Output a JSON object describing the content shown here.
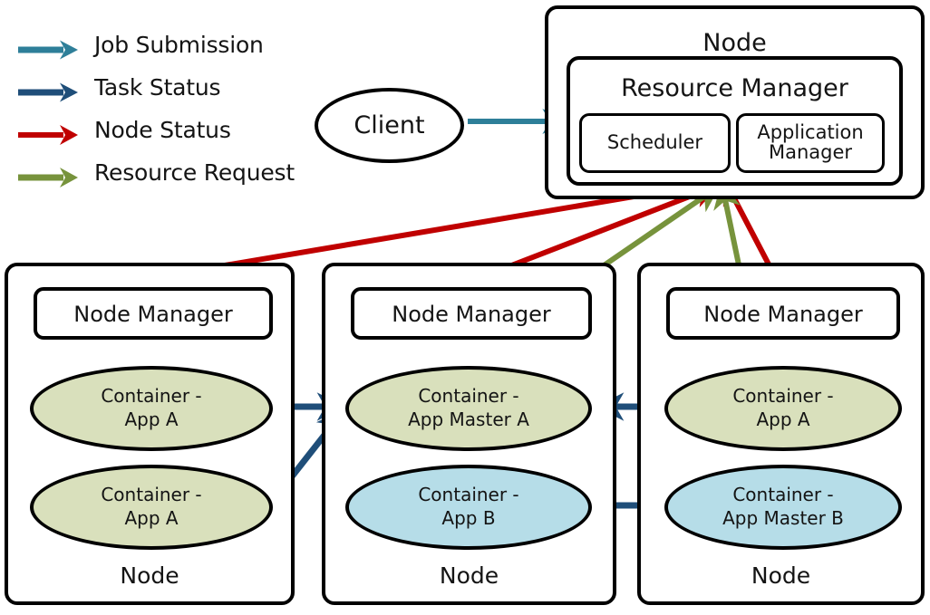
{
  "colors": {
    "job_submission": "#2E7F99",
    "task_status": "#1F4E79",
    "node_status": "#C00000",
    "resource_request": "#77933C",
    "container_app_fill": "#D9E0BC",
    "container_appb_fill": "#B6DDE8",
    "outline": "#000000",
    "text": "#141414"
  },
  "legend": {
    "items": [
      {
        "label": "Job Submission",
        "color_key": "job_submission",
        "icon": "arrow-right-icon"
      },
      {
        "label": "Task Status",
        "color_key": "task_status",
        "icon": "arrow-right-icon"
      },
      {
        "label": "Node Status",
        "color_key": "node_status",
        "icon": "arrow-right-icon"
      },
      {
        "label": "Resource Request",
        "color_key": "resource_request",
        "icon": "arrow-right-icon"
      }
    ]
  },
  "client": {
    "label": "Client"
  },
  "master_node": {
    "title": "Node",
    "resource_manager": {
      "title": "Resource Manager",
      "components": [
        {
          "label": "Scheduler"
        },
        {
          "label": "Application\nManager"
        }
      ]
    }
  },
  "worker_nodes": [
    {
      "node_manager_label": "Node Manager",
      "footer": "Node",
      "containers": [
        {
          "label": "Container -\nApp A",
          "fill_key": "container_app_fill"
        },
        {
          "label": "Container -\nApp A",
          "fill_key": "container_app_fill"
        }
      ]
    },
    {
      "node_manager_label": "Node Manager",
      "footer": "Node",
      "containers": [
        {
          "label": "Container -\nApp Master A",
          "fill_key": "container_app_fill"
        },
        {
          "label": "Container -\nApp B",
          "fill_key": "container_appb_fill"
        }
      ]
    },
    {
      "node_manager_label": "Node Manager",
      "footer": "Node",
      "containers": [
        {
          "label": "Container -\nApp A",
          "fill_key": "container_app_fill"
        },
        {
          "label": "Container -\nApp Master B",
          "fill_key": "container_appb_fill"
        }
      ]
    }
  ],
  "connections": [
    {
      "name": "client-to-resource-manager",
      "kind": "job_submission",
      "from": "Client",
      "to": "Resource Manager"
    },
    {
      "name": "nodemanager-0-status",
      "kind": "node_status",
      "from": "Node Manager (node 1)",
      "to": "Resource Manager"
    },
    {
      "name": "nodemanager-1-status",
      "kind": "node_status",
      "from": "Node Manager (node 2)",
      "to": "Resource Manager"
    },
    {
      "name": "nodemanager-2-status",
      "kind": "node_status",
      "from": "Node Manager (node 3)",
      "to": "Resource Manager"
    },
    {
      "name": "appmaster-a-resource-request",
      "kind": "resource_request",
      "from": "Container - App Master A",
      "to": "Resource Manager"
    },
    {
      "name": "appmaster-b-resource-request",
      "kind": "resource_request",
      "from": "Container - App Master B",
      "to": "Resource Manager"
    },
    {
      "name": "appa-node0-top-task-status",
      "kind": "task_status",
      "from": "Container - App A (node 1, top)",
      "to": "Container - App Master A"
    },
    {
      "name": "appa-node0-bottom-task-status",
      "kind": "task_status",
      "from": "Container - App A (node 1, bottom)",
      "to": "Container - App Master A"
    },
    {
      "name": "appa-node2-task-status",
      "kind": "task_status",
      "from": "Container - App A (node 3)",
      "to": "Container - App Master A"
    },
    {
      "name": "appb-task-status",
      "kind": "task_status",
      "from": "Container - App B (node 2)",
      "to": "Container - App Master B"
    }
  ]
}
